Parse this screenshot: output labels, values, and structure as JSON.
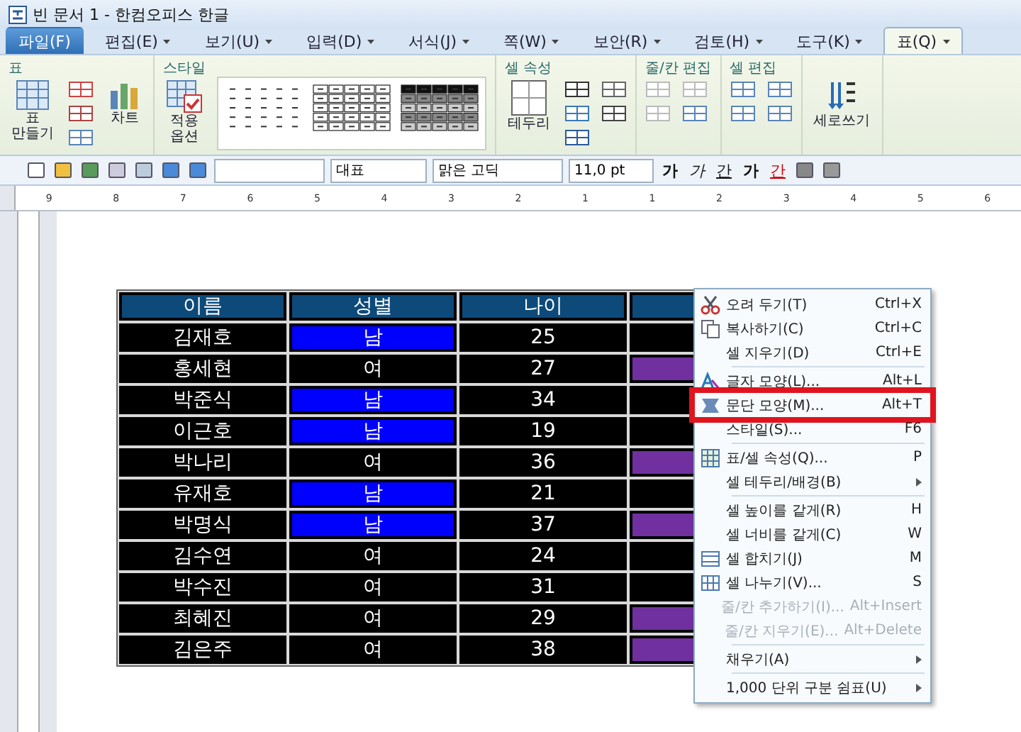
{
  "window": {
    "title": "빈 문서 1 - 한컴오피스 한글"
  },
  "menu_tabs": [
    {
      "label": "파일(F)",
      "kind": "file",
      "selected": false
    },
    {
      "label": "편집(E)",
      "kind": "tab",
      "selected": false
    },
    {
      "label": "보기(U)",
      "kind": "tab",
      "selected": false
    },
    {
      "label": "입력(D)",
      "kind": "tab",
      "selected": false
    },
    {
      "label": "서식(J)",
      "kind": "tab",
      "selected": false
    },
    {
      "label": "쪽(W)",
      "kind": "tab",
      "selected": false
    },
    {
      "label": "보안(R)",
      "kind": "tab",
      "selected": false
    },
    {
      "label": "검토(H)",
      "kind": "tab",
      "selected": false
    },
    {
      "label": "도구(K)",
      "kind": "tab",
      "selected": false
    },
    {
      "label": "표(Q)",
      "kind": "tab",
      "selected": true
    }
  ],
  "ribbon": {
    "groups": [
      {
        "title": "표",
        "buttons": [
          {
            "label": "표\n만들기"
          },
          {
            "label": "차트"
          }
        ]
      },
      {
        "title": "스타일",
        "buttons": [
          {
            "label": "적용\n옵션"
          }
        ]
      },
      {
        "title": "셀 속성",
        "buttons": [
          {
            "label": "테두리"
          }
        ]
      },
      {
        "title": "줄/칸 편집"
      },
      {
        "title": "셀 편집"
      },
      {
        "buttons": [
          {
            "label": "세로쓰기"
          }
        ]
      }
    ]
  },
  "toolbar": {
    "style": "대표",
    "font": "맑은 고딕",
    "size": "11,0",
    "unit": "pt",
    "format_buttons": [
      "가",
      "가",
      "간",
      "가",
      "간"
    ]
  },
  "ruler": {
    "labels": [
      "9",
      "8",
      "7",
      "6",
      "5",
      "4",
      "3",
      "2",
      "1",
      "1",
      "2",
      "3",
      "4",
      "5",
      "6"
    ]
  },
  "table": {
    "columns": [
      {
        "label": "이름"
      },
      {
        "label": "성별"
      },
      {
        "label": "나이"
      },
      {}
    ],
    "rows": [
      {
        "cells": [
          {
            "text": "김재호"
          },
          {
            "text": "남",
            "color": "#0000ff"
          },
          {
            "text": "25"
          },
          {}
        ]
      },
      {
        "cells": [
          {
            "text": "홍세현"
          },
          {
            "text": "여"
          },
          {
            "text": "27"
          },
          {
            "color": "#7030a0"
          }
        ]
      },
      {
        "cells": [
          {
            "text": "박준식"
          },
          {
            "text": "남",
            "color": "#0000ff"
          },
          {
            "text": "34"
          },
          {}
        ]
      },
      {
        "cells": [
          {
            "text": "이근호"
          },
          {
            "text": "남",
            "color": "#0000ff"
          },
          {
            "text": "19"
          },
          {}
        ]
      },
      {
        "cells": [
          {
            "text": "박나리"
          },
          {
            "text": "여"
          },
          {
            "text": "36"
          },
          {
            "color": "#7030a0"
          }
        ]
      },
      {
        "cells": [
          {
            "text": "유재호"
          },
          {
            "text": "남",
            "color": "#0000ff"
          },
          {
            "text": "21"
          },
          {}
        ]
      },
      {
        "cells": [
          {
            "text": "박명식"
          },
          {
            "text": "남",
            "color": "#0000ff"
          },
          {
            "text": "37"
          },
          {
            "color": "#7030a0"
          }
        ]
      },
      {
        "cells": [
          {
            "text": "김수연"
          },
          {
            "text": "여"
          },
          {
            "text": "24"
          },
          {}
        ]
      },
      {
        "cells": [
          {
            "text": "박수진"
          },
          {
            "text": "여"
          },
          {
            "text": "31"
          },
          {}
        ]
      },
      {
        "cells": [
          {
            "text": "최혜진"
          },
          {
            "text": "여"
          },
          {
            "text": "29"
          },
          {
            "color": "#7030a0"
          }
        ]
      },
      {
        "cells": [
          {
            "text": "김은주"
          },
          {
            "text": "여"
          },
          {
            "text": "38"
          },
          {
            "color": "#7030a0"
          }
        ]
      }
    ]
  },
  "context_menu": {
    "groups": [
      [
        {
          "label": "오려 두기(T)",
          "shortcut": "Ctrl+X",
          "disabled": false,
          "submenu": false,
          "highlighted": false
        },
        {
          "label": "복사하기(C)",
          "shortcut": "Ctrl+C",
          "disabled": false,
          "submenu": false,
          "highlighted": false
        },
        {
          "label": "셀 지우기(D)",
          "shortcut": "Ctrl+E",
          "disabled": false,
          "submenu": false,
          "highlighted": false
        }
      ],
      [
        {
          "label": "글자 모양(L)...",
          "shortcut": "Alt+L",
          "disabled": false,
          "submenu": false,
          "highlighted": false
        },
        {
          "label": "문단 모양(M)...",
          "shortcut": "Alt+T",
          "disabled": false,
          "submenu": false,
          "highlighted": true
        },
        {
          "label": "스타일(S)...",
          "shortcut": "F6",
          "disabled": false,
          "submenu": false,
          "highlighted": false
        }
      ],
      [
        {
          "label": "표/셀 속성(Q)...",
          "shortcut": "P",
          "disabled": false,
          "submenu": false,
          "highlighted": false
        },
        {
          "label": "셀 테두리/배경(B)",
          "disabled": false,
          "submenu": true,
          "highlighted": false
        }
      ],
      [
        {
          "label": "셀 높이를 같게(R)",
          "shortcut": "H",
          "disabled": false,
          "submenu": false,
          "highlighted": false
        },
        {
          "label": "셀 너비를 같게(C)",
          "shortcut": "W",
          "disabled": false,
          "submenu": false,
          "highlighted": false
        },
        {
          "label": "셀 합치기(J)",
          "shortcut": "M",
          "disabled": false,
          "submenu": false,
          "highlighted": false
        },
        {
          "label": "셀 나누기(V)...",
          "shortcut": "S",
          "disabled": false,
          "submenu": false,
          "highlighted": false
        },
        {
          "label": "줄/칸 추가하기(I)...",
          "shortcut": "Alt+Insert",
          "disabled": true,
          "submenu": false,
          "highlighted": false
        },
        {
          "label": "줄/칸 지우기(E)...",
          "shortcut": "Alt+Delete",
          "disabled": true,
          "submenu": false,
          "highlighted": false
        }
      ],
      [
        {
          "label": "채우기(A)",
          "disabled": false,
          "submenu": true,
          "highlighted": false
        }
      ],
      [
        {
          "label": "1,000 단위 구분 쉼표(U)",
          "disabled": false,
          "submenu": true,
          "highlighted": false
        }
      ]
    ]
  }
}
